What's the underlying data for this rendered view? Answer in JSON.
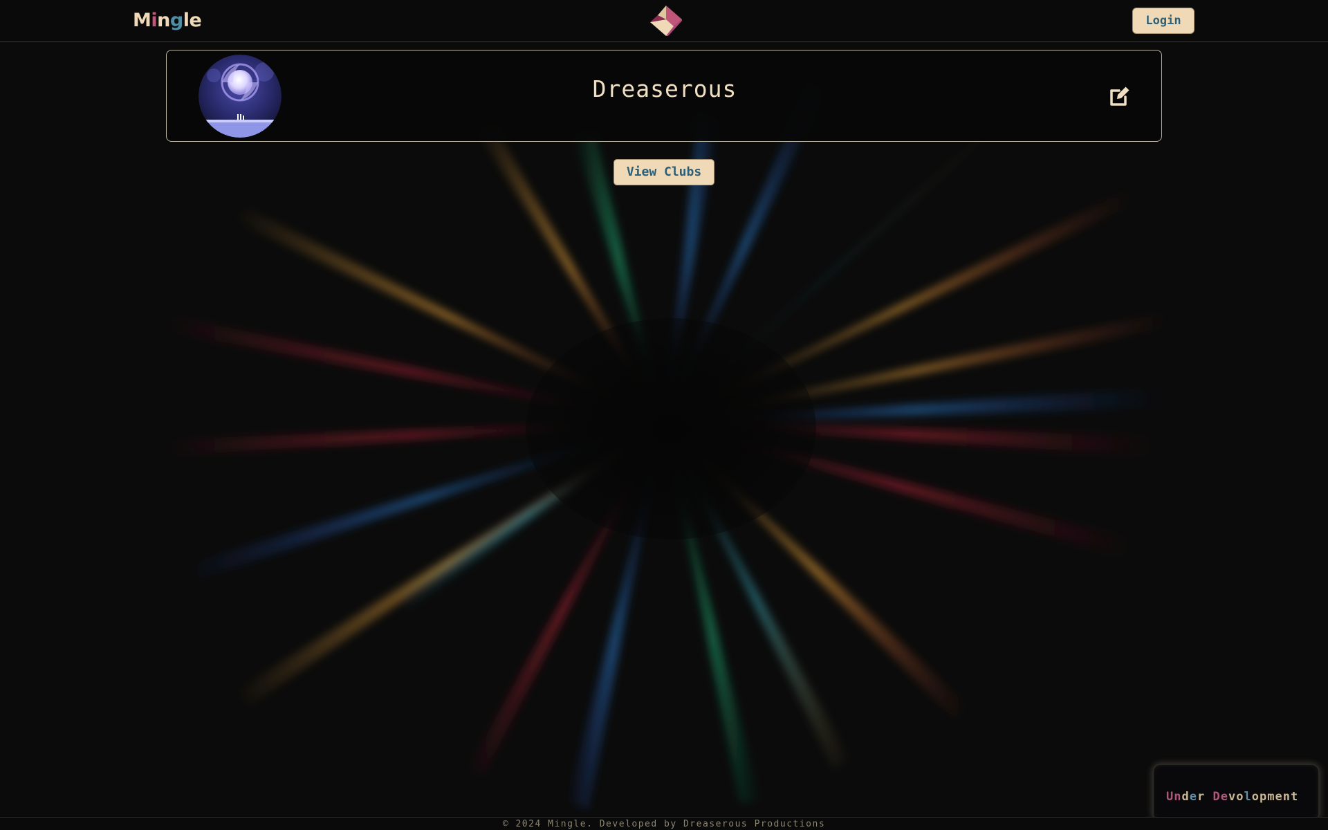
{
  "navbar": {
    "brand_letters": [
      {
        "char": "M",
        "color": "#efd9b6"
      },
      {
        "char": "i",
        "color": "#c0577a"
      },
      {
        "char": "n",
        "color": "#efd9b6"
      },
      {
        "char": "g",
        "color": "#4f8fa6"
      },
      {
        "char": "l",
        "color": "#efd9b6"
      },
      {
        "char": "e",
        "color": "#efd9b6"
      }
    ],
    "logo_icon": "diamond-logo-icon",
    "login_label": "Login"
  },
  "profile": {
    "username": "Dreaserous",
    "avatar_icon": "moon-avatar",
    "edit_icon": "edit-icon"
  },
  "actions": {
    "view_clubs_label": "View Clubs"
  },
  "badge": {
    "letters": [
      {
        "char": "U",
        "color": "#b0587a"
      },
      {
        "char": "n",
        "color": "#b0587a"
      },
      {
        "char": "d",
        "color": "#c9b896"
      },
      {
        "char": "e",
        "color": "#5f8fa4"
      },
      {
        "char": "r",
        "color": "#c9b896"
      },
      {
        "char": " ",
        "color": "#c9b896"
      },
      {
        "char": "D",
        "color": "#b0587a"
      },
      {
        "char": "e",
        "color": "#b0587a"
      },
      {
        "char": "v",
        "color": "#c9b896"
      },
      {
        "char": "o",
        "color": "#c9b896"
      },
      {
        "char": "l",
        "color": "#5f8fa4"
      },
      {
        "char": "o",
        "color": "#c9b896"
      },
      {
        "char": "p",
        "color": "#c9b896"
      },
      {
        "char": "m",
        "color": "#c9b896"
      },
      {
        "char": "e",
        "color": "#c9b896"
      },
      {
        "char": "n",
        "color": "#c9b896"
      },
      {
        "char": "t",
        "color": "#c9b896"
      }
    ]
  },
  "footer": {
    "text": "© 2024 Mingle. Developed by Dreaserous Productions"
  },
  "colors": {
    "accent_cream": "#efd9b6",
    "accent_blue": "#2c5f78",
    "accent_pink": "#c0577a",
    "background": "#0b0b0b"
  }
}
